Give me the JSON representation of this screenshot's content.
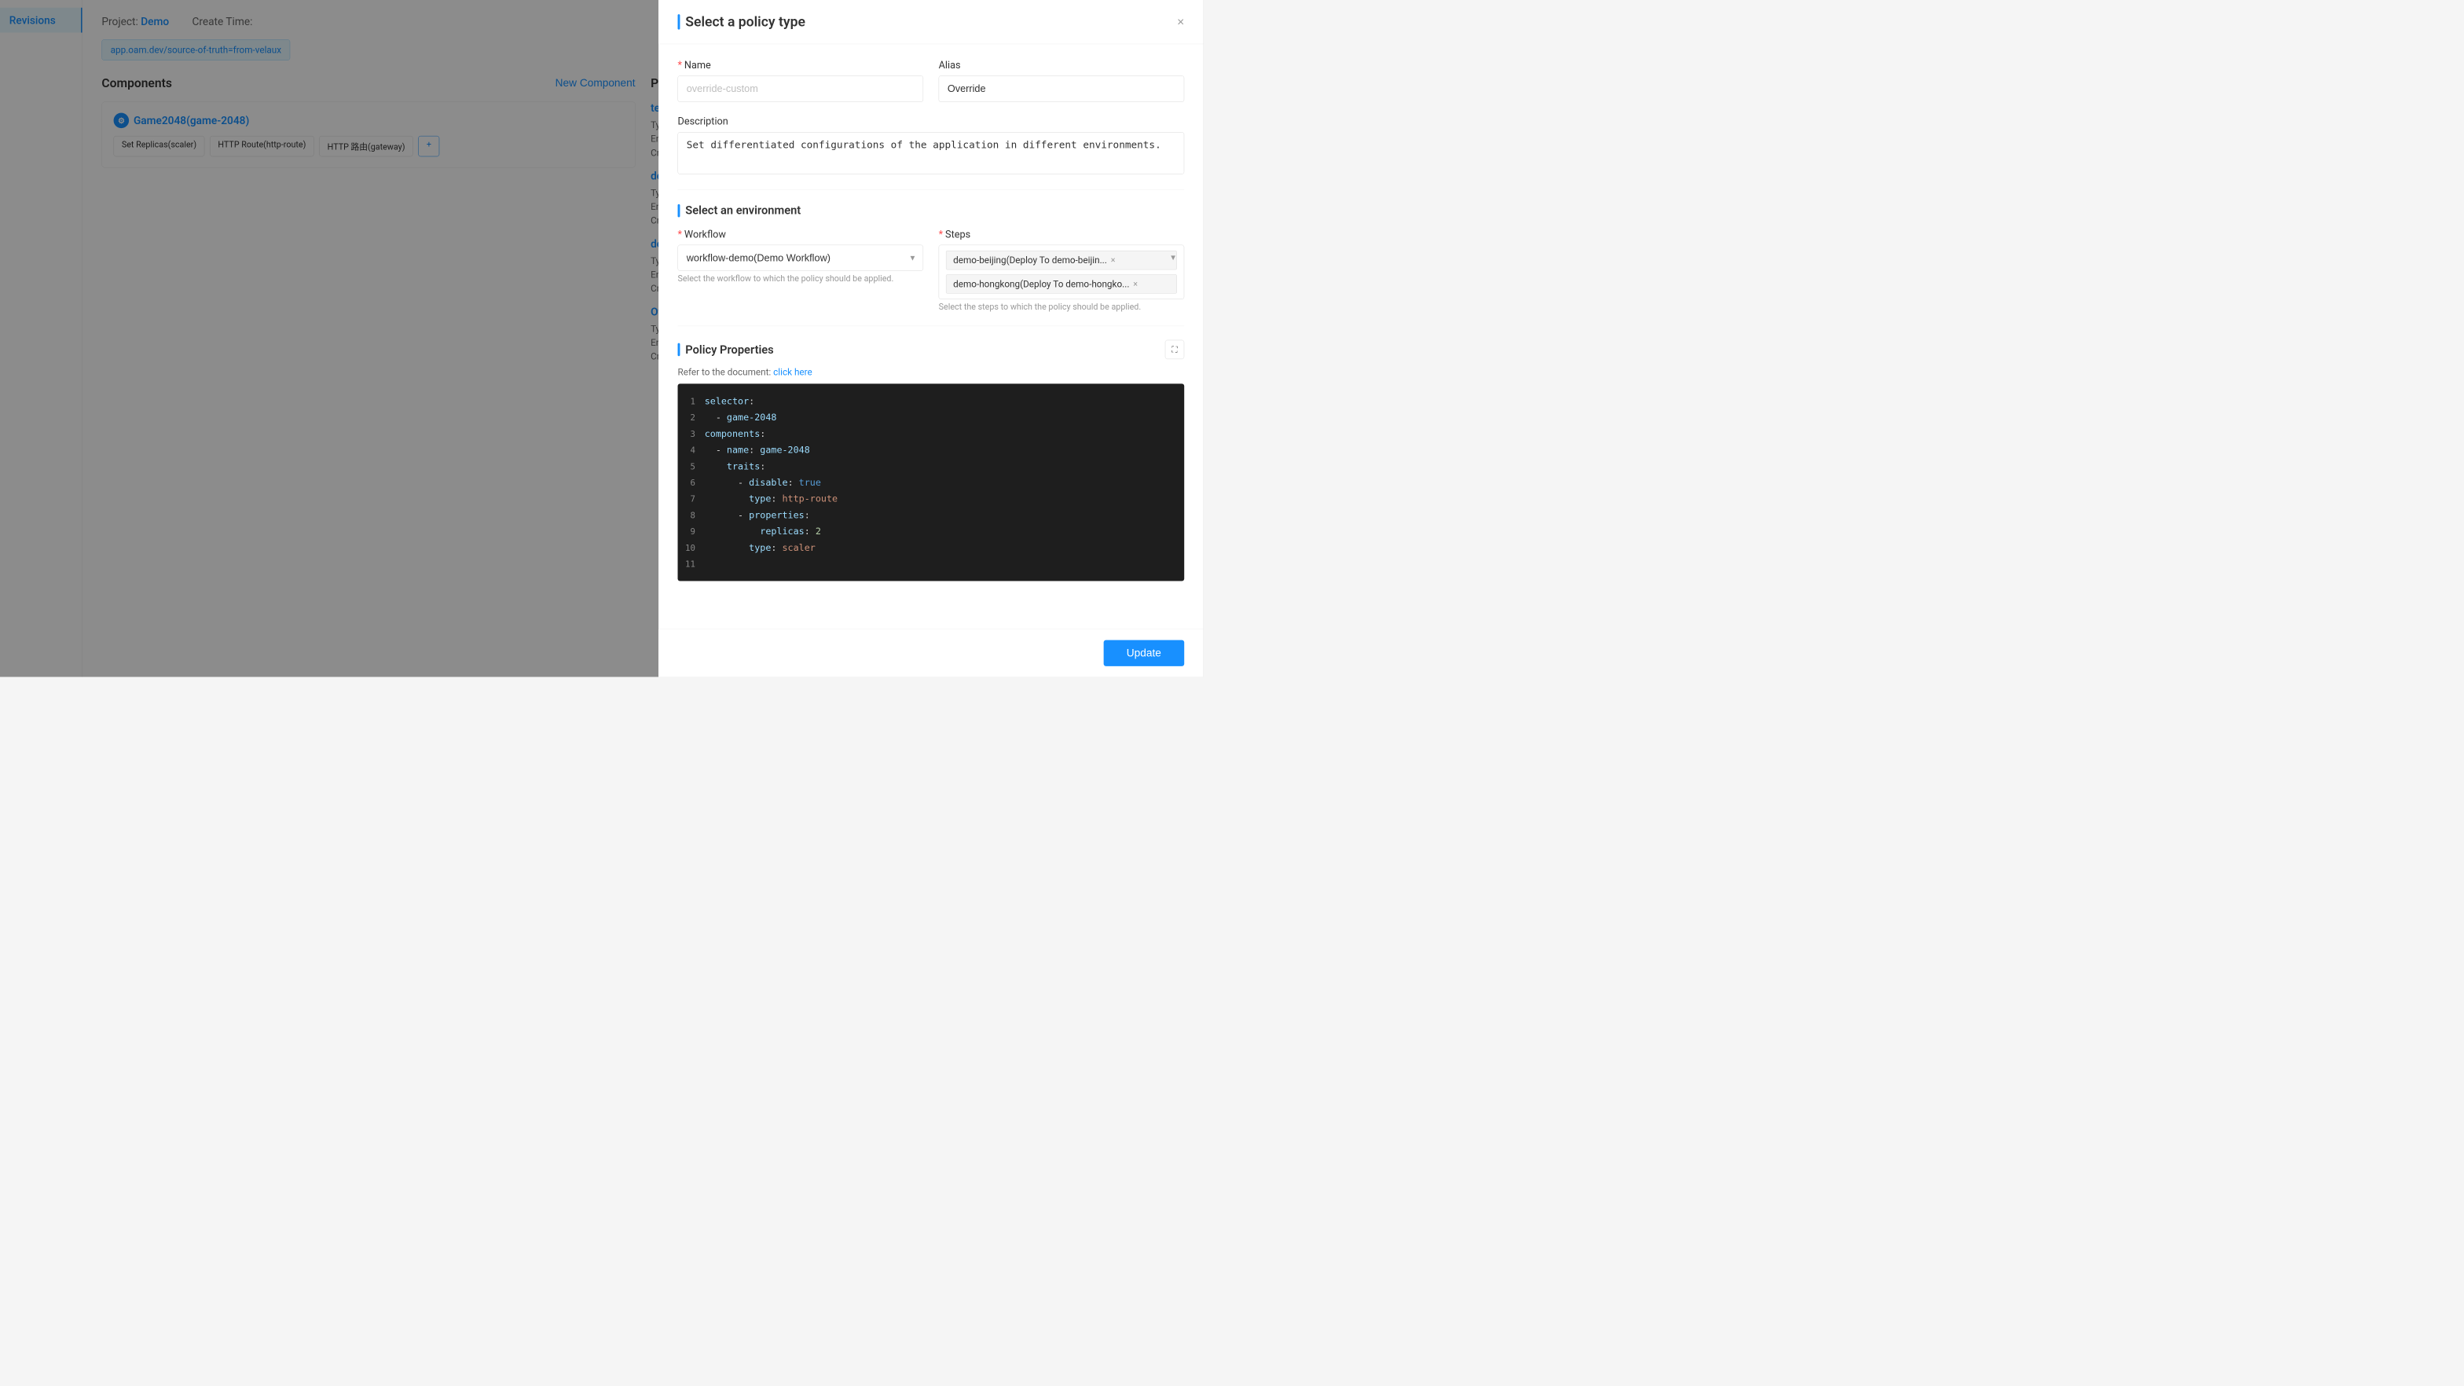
{
  "sidebar": {
    "items": [
      {
        "label": "Revisions",
        "active": true
      }
    ]
  },
  "main": {
    "project_label": "Project:",
    "project_value": "Demo",
    "create_time_label": "Create Time:",
    "tag": "app.oam.dev/source-of-truth=from-velaux",
    "components_title": "Components",
    "new_component_btn": "New Component",
    "policies_title": "Policies",
    "component": {
      "name": "Game2048(game-2048)",
      "traits": [
        {
          "label": "Set Replicas(scaler)"
        },
        {
          "label": "HTTP Route(http-route)"
        },
        {
          "label": "HTTP 路由(gateway)"
        },
        {
          "label": "+"
        }
      ]
    },
    "policies": [
      {
        "name": "test",
        "type_label": "Type:",
        "environment_label": "Environment",
        "create_time_label": "Create Ti..."
      },
      {
        "name": "demo-beij...",
        "type_label": "Type:",
        "environment_label": "Environment",
        "create_time_label": "Create Ti..."
      },
      {
        "name": "demo-hon...",
        "type_label": "Type:",
        "environment_label": "Environment",
        "create_time_label": "Create Ti..."
      },
      {
        "name": "Override",
        "type_label": "Type:",
        "environment_label": "Environment",
        "create_time_label": "Create Ti..."
      }
    ]
  },
  "drawer": {
    "title": "Select a policy type",
    "close_icon": "×",
    "name_label": "Name",
    "name_required": "*",
    "name_placeholder": "override-custom",
    "alias_label": "Alias",
    "alias_value": "Override",
    "description_label": "Description",
    "description_value": "Set differentiated configurations of the application in different environments.",
    "select_env_title": "Select an environment",
    "workflow_label": "Workflow",
    "workflow_required": "*",
    "workflow_value": "workflow-demo(Demo Workflow)",
    "workflow_hint": "Select the workflow to which the policy should be applied.",
    "steps_label": "Steps",
    "steps_required": "*",
    "steps_hint": "Select the steps to which the policy should be applied.",
    "steps_selected": [
      {
        "label": "demo-beijing(Deploy To demo-beijin..."
      },
      {
        "label": "demo-hongkong(Deploy To demo-hongko..."
      }
    ],
    "policy_props_title": "Policy Properties",
    "doc_ref_text": "Refer to the document:",
    "doc_ref_link": "click here",
    "code_lines": [
      {
        "num": 1,
        "tokens": [
          {
            "t": "key",
            "v": "selector"
          },
          {
            "t": "p",
            "v": ":"
          }
        ]
      },
      {
        "num": 2,
        "tokens": [
          {
            "t": "p",
            "v": "  - "
          },
          {
            "t": "key",
            "v": "game-2048"
          }
        ]
      },
      {
        "num": 3,
        "tokens": [
          {
            "t": "key",
            "v": "components"
          },
          {
            "t": "p",
            "v": ":"
          }
        ]
      },
      {
        "num": 4,
        "tokens": [
          {
            "t": "p",
            "v": "  - "
          },
          {
            "t": "key",
            "v": "name"
          },
          {
            "t": "p",
            "v": ": "
          },
          {
            "t": "str",
            "v": "game-2048"
          }
        ]
      },
      {
        "num": 5,
        "tokens": [
          {
            "t": "p",
            "v": "    "
          },
          {
            "t": "key",
            "v": "traits"
          },
          {
            "t": "p",
            "v": ":"
          }
        ]
      },
      {
        "num": 6,
        "tokens": [
          {
            "t": "p",
            "v": "      - "
          },
          {
            "t": "key",
            "v": "disable"
          },
          {
            "t": "p",
            "v": ": "
          },
          {
            "t": "bool",
            "v": "true"
          }
        ]
      },
      {
        "num": 7,
        "tokens": [
          {
            "t": "p",
            "v": "        "
          },
          {
            "t": "key",
            "v": "type"
          },
          {
            "t": "p",
            "v": ": "
          },
          {
            "t": "str",
            "v": "http-route"
          }
        ]
      },
      {
        "num": 8,
        "tokens": [
          {
            "t": "p",
            "v": "      - "
          },
          {
            "t": "key",
            "v": "properties"
          },
          {
            "t": "p",
            "v": ":"
          }
        ]
      },
      {
        "num": 9,
        "tokens": [
          {
            "t": "p",
            "v": "          "
          },
          {
            "t": "key",
            "v": "replicas"
          },
          {
            "t": "p",
            "v": ": "
          },
          {
            "t": "num",
            "v": "2"
          }
        ]
      },
      {
        "num": 10,
        "tokens": [
          {
            "t": "p",
            "v": "        "
          },
          {
            "t": "key",
            "v": "type"
          },
          {
            "t": "p",
            "v": ": "
          },
          {
            "t": "str",
            "v": "scaler"
          }
        ]
      },
      {
        "num": 11,
        "tokens": []
      }
    ],
    "update_btn": "Update"
  }
}
